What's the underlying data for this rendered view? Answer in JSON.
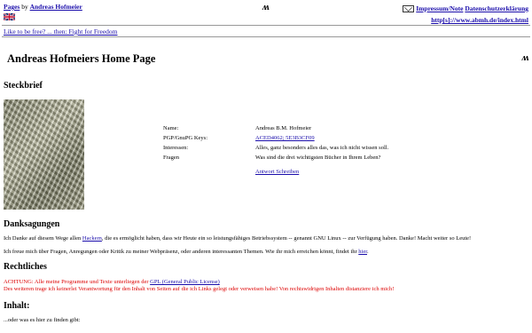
{
  "topbar": {
    "pages_link": "Pages",
    "by": " by ",
    "author_link": "Andreas Hofmeier",
    "logo_glyph": "ᴧᴧ",
    "impressum": "Impressum/Note",
    "datenschutz": "Datenschutzerklärung",
    "url_link": "http[s]://www.abmh.de/index.html"
  },
  "freedom_link": "Like to be free? ... then: Fight for Freedom",
  "page_title": "Andreas Hofmeiers Home Page",
  "steckbrief": {
    "heading": "Steckbrief",
    "rows": [
      {
        "key": "Name:",
        "value": "Andreas B.M. Hofmeier",
        "link": false
      },
      {
        "key": "PGP/GnuPG Keys:",
        "value": "ACED4062; 5E3B3CF09",
        "link": true
      },
      {
        "key": "Interessen:",
        "value": "Alles, ganz besonders alles das, was ich nicht wissen soll.",
        "link": false
      },
      {
        "key": "Fragen",
        "value": "Was sind die drei wichtigsten Bücher in Ihrem Leben?",
        "link": false
      }
    ],
    "answer_link": "Antwort Schreiben"
  },
  "danksagungen": {
    "heading": "Danksagungen",
    "p1_a": "Ich Danke auf diesem Wege allen ",
    "p1_link": "Hackern",
    "p1_b": ", die es ermöglicht haben, dass wir Heute ein so leistungsfähiges Betriebssystem -- genannt GNU Linux -- zur Verfügung haben. Danke! Macht weiter so Leute!",
    "p2_a": "Ich freue mich über Fragen, Anregungen oder Kritik zu meiner Webpräsenz, oder anderen interessanten Themen. Wie ihr mich erreichen könnt, findet ihr ",
    "p2_link": "hier",
    "p2_b": "."
  },
  "rechtliches": {
    "heading": "Rechtliches",
    "p1_a": "ACHTUNG: Alle meine Programme und Texte unterliegen der ",
    "p1_link": "GPL (General Public License)",
    "p1_b": "",
    "p2": "Des weiteren trage ich keinerlei Verantwortung für den Inhalt von Seiten auf die ich Links gelegt oder verweisen habe! Von rechtswidrigen Inhalten distanziere ich mich!"
  },
  "inhalt": {
    "heading": "Inhalt:",
    "p1": "...oder was es hier zu finden gibt:"
  },
  "colors": {
    "link": "#1a0dab",
    "warning": "#dd0000"
  }
}
